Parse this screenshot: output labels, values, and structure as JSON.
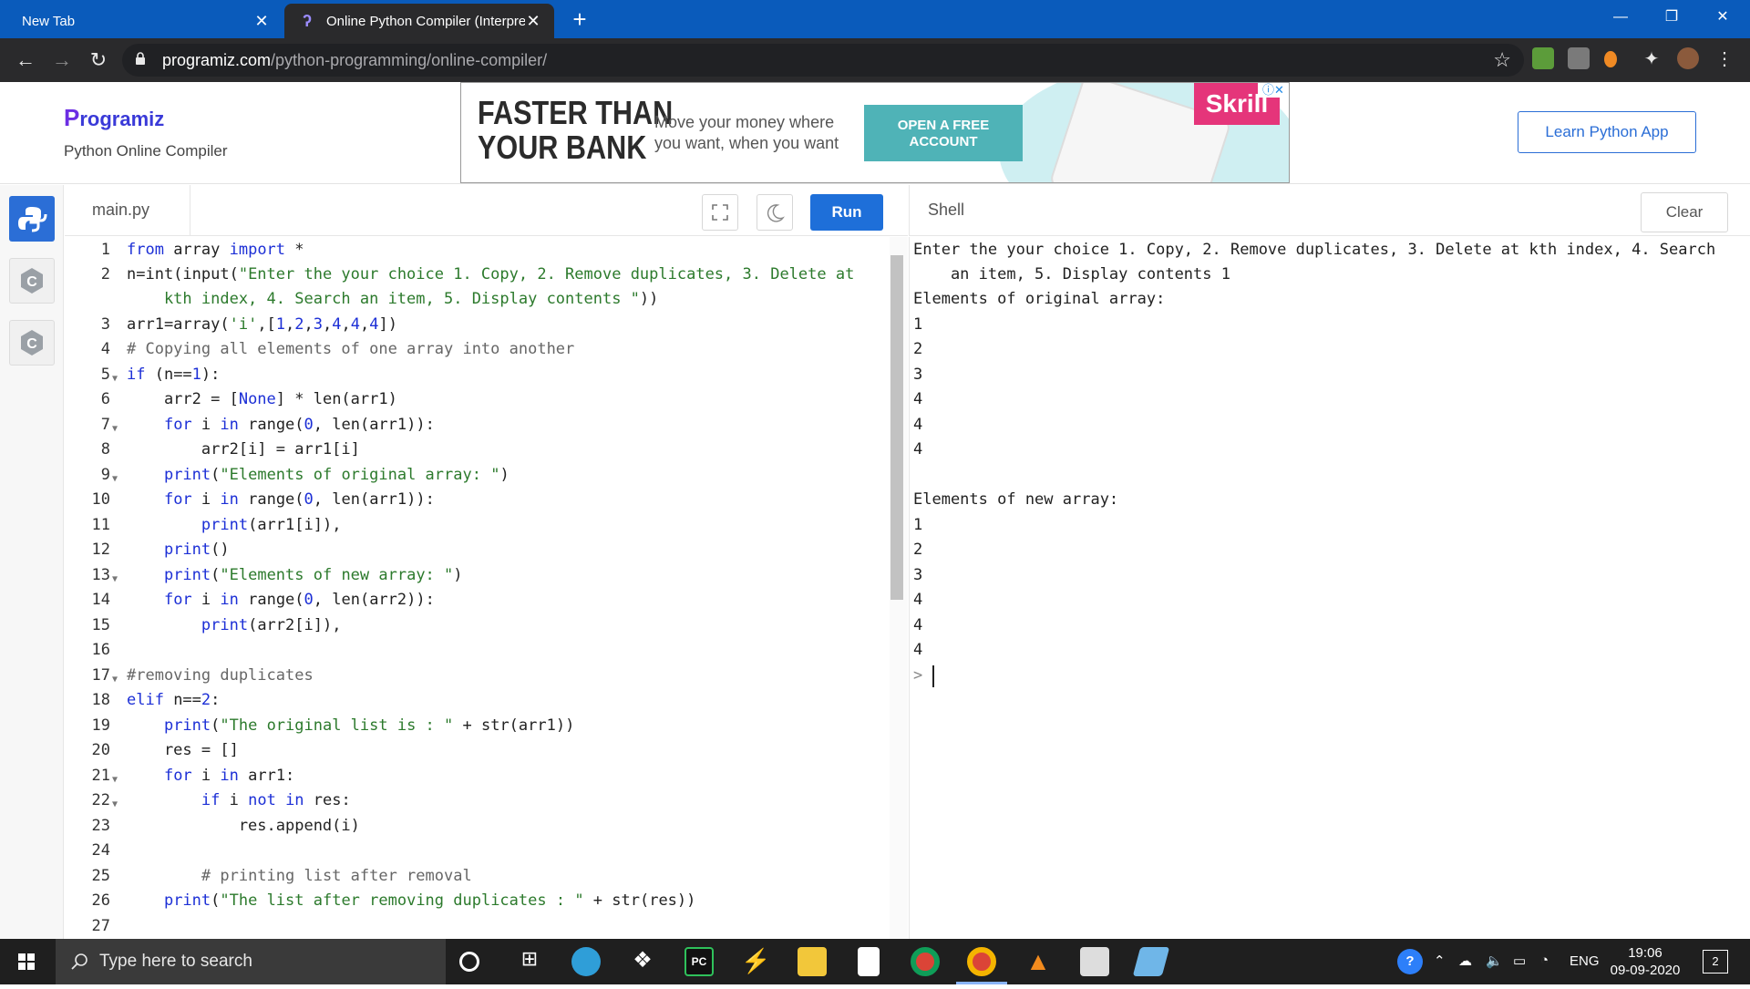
{
  "browser": {
    "tabs": [
      {
        "label": "New Tab"
      },
      {
        "label": "Online Python Compiler (Interpre"
      }
    ],
    "url_domain": "programiz.com",
    "url_path": "/python-programming/online-compiler/"
  },
  "header": {
    "logo": "Programiz",
    "logo_initial": "P",
    "logo_rest": "rogramiz",
    "subtitle": "Python Online Compiler",
    "learn_button": "Learn Python App"
  },
  "ad": {
    "headline_1": "FASTER THAN",
    "headline_2": "YOUR BANK",
    "body_1": "Move your money where",
    "body_2": "you want, when you want",
    "cta_1": "OPEN A FREE",
    "cta_2": "ACCOUNT",
    "brand": "Skrill"
  },
  "editor": {
    "filename": "main.py",
    "run_label": "Run",
    "line_numbers": [
      "1",
      "2",
      "",
      "3",
      "4",
      "5",
      "6",
      "7",
      "8",
      "9",
      "10",
      "11",
      "12",
      "13",
      "14",
      "15",
      "16",
      "17",
      "18",
      "19",
      "20",
      "21",
      "22",
      "23",
      "24",
      "25",
      "26",
      "27"
    ]
  },
  "shell": {
    "title": "Shell",
    "clear_label": "Clear",
    "lines": [
      "Enter the your choice 1. Copy, 2. Remove duplicates, 3. Delete at kth index, 4. Search",
      "    an item, 5. Display contents 1",
      "Elements of original array:",
      "1",
      "2",
      "3",
      "4",
      "4",
      "4",
      "",
      "Elements of new array:",
      "1",
      "2",
      "3",
      "4",
      "4",
      "4",
      "> "
    ]
  },
  "taskbar": {
    "search_placeholder": "Type here to search",
    "language": "ENG",
    "time": "19:06",
    "date": "09-09-2020",
    "notification_count": "2"
  },
  "colors": {
    "accent": "#1e6fd9",
    "tabbar": "#0a5bbb",
    "chrome_dark": "#2a2a2c"
  }
}
